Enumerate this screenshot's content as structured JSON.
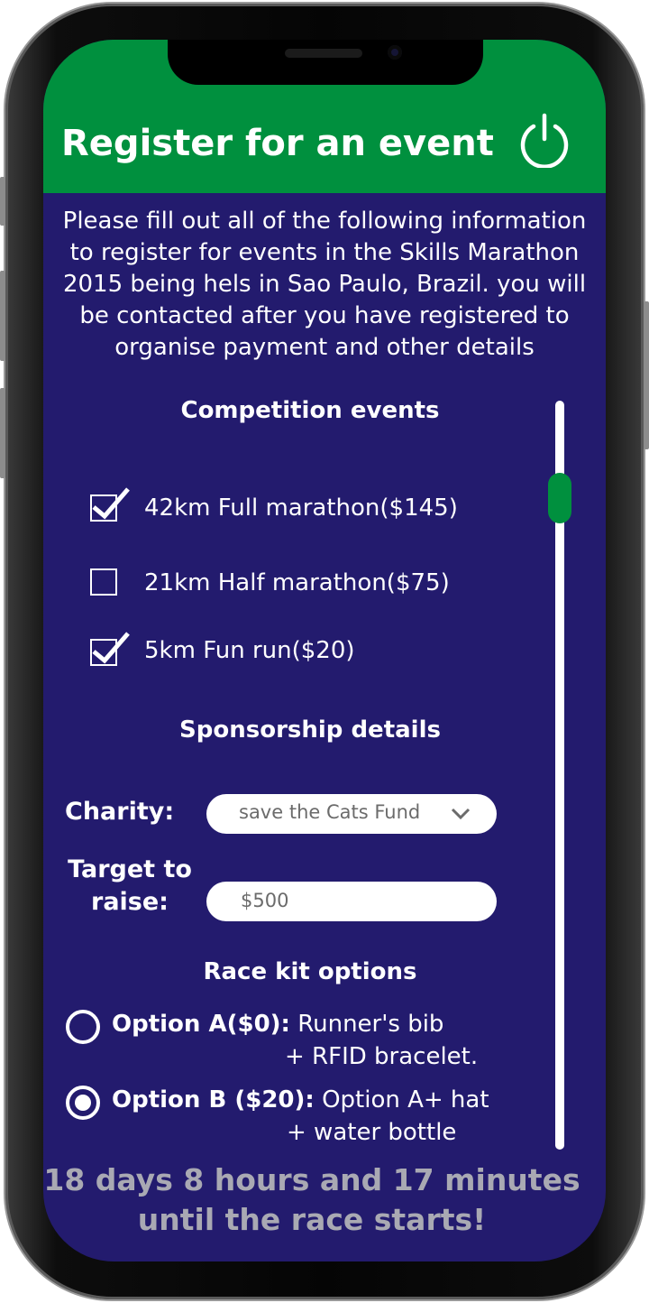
{
  "header": {
    "title": "Register for an event",
    "power_icon": "power-icon"
  },
  "intro": {
    "lines": [
      "Please fill out all of the following information",
      "to register for events in the Skills Marathon",
      "2015 being hels in Sao Paulo, Brazil. you will",
      "be contacted after you have registered to",
      "organise payment and other details"
    ]
  },
  "competition": {
    "heading": "Competition events",
    "events": [
      {
        "label": "42km Full marathon($145)",
        "checked": true
      },
      {
        "label": "21km Half marathon($75)",
        "checked": false
      },
      {
        "label": "5km Fun run($20)",
        "checked": true
      }
    ]
  },
  "sponsorship": {
    "heading": "Sponsorship details",
    "charity_label": "Charity:",
    "charity_value": "save the Cats Fund",
    "target_label_line1": "Target to",
    "target_label_line2": "raise:",
    "target_value": "$500"
  },
  "race_kit": {
    "heading": "Race kit options",
    "options": [
      {
        "name": "Option A($0):",
        "desc_line1": "Runner's bib",
        "desc_line2": "+ RFID bracelet.",
        "selected": false
      },
      {
        "name": "Option B ($20):",
        "desc_line1": "Option A+ hat",
        "desc_line2": "+ water bottle",
        "selected": true
      }
    ]
  },
  "countdown": {
    "line1": "18 days 8 hours and 17 minutes",
    "line2": "until the race starts!"
  },
  "colors": {
    "header_green": "#00903e",
    "background_navy": "#231b6e",
    "countdown_gray": "#a9a9b3"
  }
}
